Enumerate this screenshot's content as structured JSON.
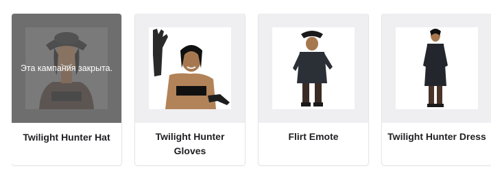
{
  "items": [
    {
      "name": "Twilight Hunter Hat",
      "status": "Эта кампания закрыта.",
      "closed": true
    },
    {
      "name": "Twilight Hunter Gloves",
      "closed": false
    },
    {
      "name": "Flirt Emote",
      "closed": false
    },
    {
      "name": "Twilight Hunter Dress",
      "closed": false
    }
  ],
  "colors": {
    "card_bg": "#efeff1",
    "closed_bg": "#6e6e6e",
    "title": "#1f1f23"
  }
}
